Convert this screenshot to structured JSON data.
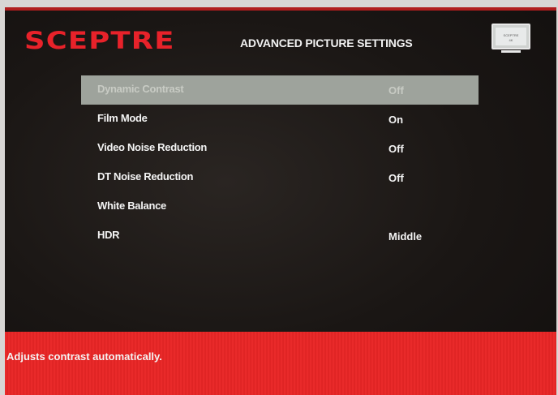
{
  "brand": "SCEPTRE",
  "page_title": "ADVANCED PICTURE SETTINGS",
  "tv_icon": {
    "line1": "SCEPTRE",
    "line2": "4K"
  },
  "menu": {
    "items": [
      {
        "label": "Dynamic Contrast",
        "value": "Off",
        "selected": true
      },
      {
        "label": "Film Mode",
        "value": "On"
      },
      {
        "label": "Video Noise Reduction",
        "value": "Off"
      },
      {
        "label": "DT Noise Reduction",
        "value": "Off"
      },
      {
        "label": "White Balance",
        "value": ""
      },
      {
        "label": "HDR",
        "value": "Middle"
      }
    ]
  },
  "help_text": "Adjusts contrast automatically.",
  "colors": {
    "brand_red": "#e8222a",
    "help_bar_red": "#e62727",
    "selection": "#9ea39c"
  }
}
